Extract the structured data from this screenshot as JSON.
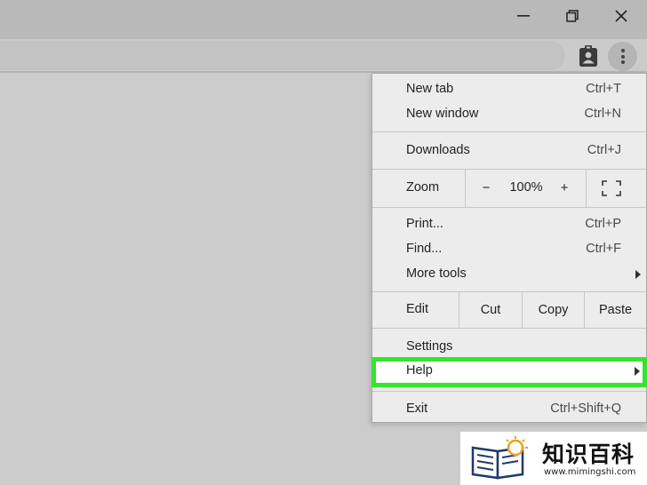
{
  "window_controls": {
    "minimize_icon": "minimize-icon",
    "restore_icon": "restore-icon",
    "close_icon": "close-icon"
  },
  "toolbar": {
    "profile_icon": "profile-badge-icon",
    "menu_icon": "three-dots-vertical-icon"
  },
  "menu": {
    "new_tab": {
      "label": "New tab",
      "shortcut": "Ctrl+T"
    },
    "new_window": {
      "label": "New window",
      "shortcut": "Ctrl+N"
    },
    "downloads": {
      "label": "Downloads",
      "shortcut": "Ctrl+J"
    },
    "zoom": {
      "label": "Zoom",
      "minus": "−",
      "value": "100%",
      "plus": "+"
    },
    "print": {
      "label": "Print...",
      "shortcut": "Ctrl+P"
    },
    "find": {
      "label": "Find...",
      "shortcut": "Ctrl+F"
    },
    "more_tools": {
      "label": "More tools"
    },
    "edit": {
      "label": "Edit",
      "cut": "Cut",
      "copy": "Copy",
      "paste": "Paste"
    },
    "settings": {
      "label": "Settings"
    },
    "help": {
      "label": "Help"
    },
    "exit": {
      "label": "Exit",
      "shortcut": "Ctrl+Shift+Q"
    }
  },
  "colors": {
    "highlight": "#33e62d",
    "menu_bg": "#ececec",
    "page_bg": "#cccccc"
  },
  "watermark": {
    "title": "知识百科",
    "url": "www.mimingshi.com"
  }
}
